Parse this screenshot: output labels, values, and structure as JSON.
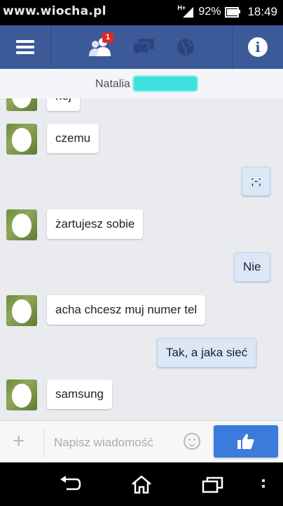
{
  "status_bar": {
    "watermark": "www.wiocha.pl",
    "network": "H+",
    "battery_percent": "92%",
    "battery_level": 0.92,
    "time": "18:49"
  },
  "top_bar": {
    "friend_requests_badge": "1",
    "icons": [
      "menu-icon",
      "friends-icon",
      "messages-icon",
      "globe-icon",
      "info-icon"
    ],
    "color": "#3c5a98"
  },
  "conversation": {
    "contact_name": "Natalia"
  },
  "messages": [
    {
      "side": "in",
      "text": "hej"
    },
    {
      "side": "in",
      "text": "czemu"
    },
    {
      "side": "out",
      "text": ";-;"
    },
    {
      "side": "in",
      "text": "żartujesz sobie"
    },
    {
      "side": "out",
      "text": "Nie"
    },
    {
      "side": "in",
      "text": "acha chcesz muj numer tel"
    },
    {
      "side": "out",
      "text": "Tak,  a jaka sieć"
    },
    {
      "side": "in",
      "text": "samsung"
    }
  ],
  "composer": {
    "placeholder": "Napisz wiadomość",
    "like_color": "#3a7bdb"
  },
  "nav_bar": {
    "icons": [
      "back-icon",
      "home-icon",
      "recent-apps-icon"
    ]
  }
}
